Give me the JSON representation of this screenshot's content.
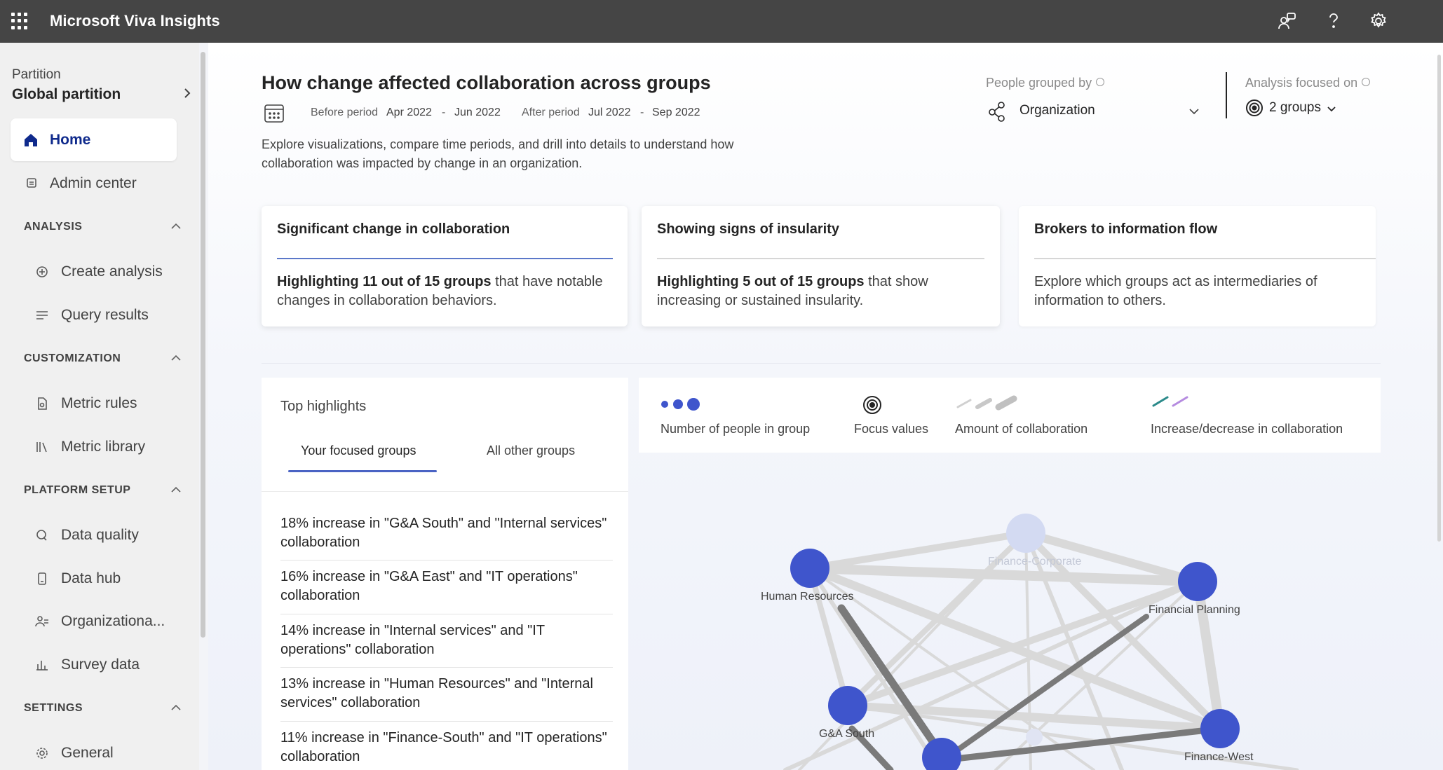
{
  "app": {
    "title": "Microsoft Viva Insights"
  },
  "topbar_icons": [
    "people-feedback-icon",
    "help-icon",
    "settings-icon"
  ],
  "sidebar": {
    "partition_label": "Partition",
    "partition_value": "Global partition",
    "home": "Home",
    "admin_center": "Admin center",
    "sections": {
      "analysis": {
        "label": "ANALYSIS",
        "items": [
          "Create analysis",
          "Query results"
        ]
      },
      "customization": {
        "label": "CUSTOMIZATION",
        "items": [
          "Metric rules",
          "Metric library"
        ]
      },
      "platform_setup": {
        "label": "PLATFORM SETUP",
        "items": [
          "Data quality",
          "Data hub",
          "Organizationa...",
          "Survey data"
        ]
      },
      "settings": {
        "label": "SETTINGS",
        "items": [
          "General"
        ]
      }
    }
  },
  "header": {
    "title": "How change affected collaboration across groups",
    "before_label": "Before period",
    "before_start": "Apr 2022",
    "before_end": "Jun 2022",
    "after_label": "After period",
    "after_start": "Jul 2022",
    "after_end": "Sep 2022",
    "range_dash": "-",
    "description": "Explore visualizations, compare time periods, and drill into details to understand how collaboration was impacted by change in an organization.",
    "grouped_by_label": "People grouped by",
    "grouped_by_value": "Organization",
    "focused_on_label": "Analysis focused on",
    "focused_on_value": "2 groups"
  },
  "cards": [
    {
      "title": "Significant change in collaboration",
      "bold": "Highlighting 11 out of 15 groups",
      "rest": " that have notable changes in collaboration behaviors."
    },
    {
      "title": "Showing signs of insularity",
      "bold": "Highlighting 5 out of 15 groups",
      "rest": " that show increasing or sustained insularity."
    },
    {
      "title": "Brokers to information flow",
      "bold": "",
      "rest": "Explore which groups act as intermediaries of information to others."
    }
  ],
  "highlights": {
    "title": "Top highlights",
    "tab_focused": "Your focused groups",
    "tab_other": "All other groups",
    "items": [
      "18% increase in \"G&A South\" and \"Internal services\" collaboration",
      "16% increase in \"G&A East\" and \"IT operations\" collaboration",
      "14% increase in \"Internal services\" and \"IT operations\" collaboration",
      "13% increase in \"Human Resources\" and \"Internal services\" collaboration",
      "11% increase in \"Finance-South\" and \"IT operations\" collaboration"
    ]
  },
  "legend": {
    "people": "Number of people in group",
    "focus": "Focus values",
    "amount": "Amount of collaboration",
    "change": "Increase/decrease in collaboration"
  },
  "graph": {
    "nodes": {
      "finance_corporate": "Finance-Corporate",
      "human_resources": "Human Resources",
      "financial_planning": "Financial Planning",
      "ga_south": "G&A South",
      "finance_west": "Finance-West"
    }
  },
  "colors": {
    "topbar": "#454545",
    "accent": "#4a63c4",
    "node": "#3f55cc",
    "node_faded": "#d3daf2",
    "edge_light": "#d0d0d0",
    "edge_dark": "#7a7a7a"
  }
}
